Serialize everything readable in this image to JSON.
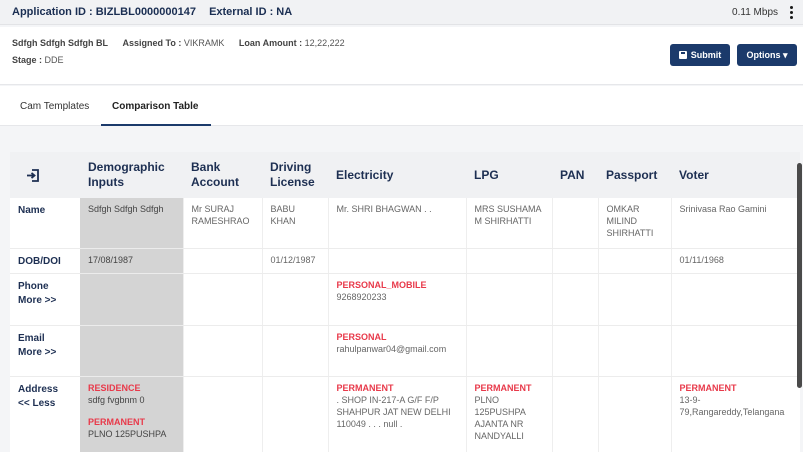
{
  "topbar": {
    "application_id": "Application ID : BIZLBL0000000147",
    "external_id": "External ID : NA",
    "speed": "0.11 Mbps"
  },
  "header": {
    "applicant": "Sdfgh Sdfgh Sdfgh",
    "product": "BL",
    "assigned_label": "Assigned To :",
    "assigned_value": "VIKRAMK",
    "loan_label": "Loan Amount :",
    "loan_value": "12,22,222",
    "stage_label": "Stage :",
    "stage_value": "DDE",
    "submit_label": "Submit",
    "options_label": "Options ▾"
  },
  "tabs": [
    {
      "label": "Cam Templates"
    },
    {
      "label": "Comparison Table"
    }
  ],
  "table": {
    "columns": [
      "Demographic Inputs",
      "Bank Account",
      "Driving License",
      "Electricity",
      "LPG",
      "PAN",
      "Passport",
      "Voter"
    ],
    "rows": {
      "name": {
        "label": "Name",
        "cells": [
          "Sdfgh Sdfgh Sdfgh",
          "Mr SURAJ RAMESHRAO",
          "BABU KHAN",
          "Mr. SHRI BHAGWAN . .",
          "MRS SUSHAMA M SHIRHATTI",
          "",
          "OMKAR MILIND SHIRHATTI",
          "Srinivasa Rao Gamini"
        ]
      },
      "dob": {
        "label": "DOB/DOI",
        "cells": [
          "17/08/1987",
          "",
          "01/12/1987",
          "",
          "",
          "",
          "",
          "01/11/1968"
        ]
      },
      "phone": {
        "label": "Phone",
        "more": "More >>",
        "electricity_tag": "PERSONAL_MOBILE",
        "electricity_value": "9268920233"
      },
      "email": {
        "label": "Email",
        "more": "More >>",
        "electricity_tag": "PERSONAL",
        "electricity_value": "rahulpanwar04@gmail.com"
      },
      "address": {
        "label": "Address",
        "less": "<< Less",
        "demo_tag1": "RESIDENCE",
        "demo_value1": "sdfg fvgbnm 0",
        "demo_tag2": "PERMANENT",
        "demo_value2": "PLNO 125PUSHPA",
        "electricity_tag": "PERMANENT",
        "electricity_value": ". SHOP IN-217-A G/F F/P SHAHPUR JAT NEW DELHI 110049 . . . null .",
        "lpg_tag": "PERMANENT",
        "lpg_value": "PLNO 125PUSHPA AJANTA NR NANDYALLI",
        "voter_tag": "PERMANENT",
        "voter_value": "13-9-79,Rangareddy,Telangana"
      }
    }
  }
}
